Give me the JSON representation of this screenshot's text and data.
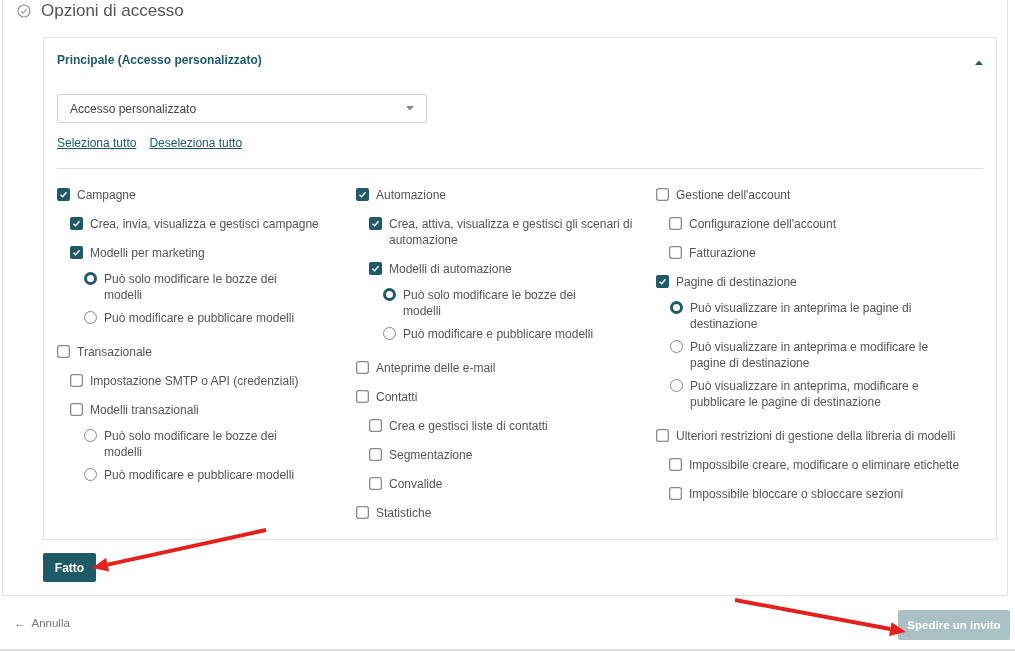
{
  "section": {
    "title": "Opzioni di accesso"
  },
  "card": {
    "title": "Principale (Accesso personalizzato)",
    "expanded": true,
    "select": {
      "value": "Accesso personalizzato"
    },
    "links": [
      "Seleziona tutto",
      "Deseleziona tutto"
    ],
    "columns": [
      [
        {
          "kind": "checkbox",
          "label": "Campagne",
          "checked": true,
          "children": [
            {
              "kind": "checkbox",
              "label": "Crea, invia, visualizza e gestisci campagne",
              "checked": true
            },
            {
              "kind": "checkbox",
              "label": "Modelli per marketing",
              "checked": true,
              "children": [
                {
                  "kind": "radio",
                  "label": "Può solo modificare le bozze dei modelli",
                  "selected": true
                },
                {
                  "kind": "radio",
                  "label": "Può modificare e pubblicare modelli",
                  "selected": false
                }
              ]
            }
          ]
        },
        {
          "kind": "checkbox",
          "label": "Transazionale",
          "checked": false,
          "children": [
            {
              "kind": "checkbox",
              "label": "Impostazione SMTP o API (credenziali)",
              "checked": false
            },
            {
              "kind": "checkbox",
              "label": "Modelli transazionali",
              "checked": false,
              "children": [
                {
                  "kind": "radio",
                  "label": "Può solo modificare le bozze dei modelli",
                  "selected": false
                },
                {
                  "kind": "radio",
                  "label": "Può modificare e pubblicare modelli",
                  "selected": false
                }
              ]
            }
          ]
        }
      ],
      [
        {
          "kind": "checkbox",
          "label": "Automazione",
          "checked": true,
          "children": [
            {
              "kind": "checkbox",
              "label": "Crea, attiva, visualizza e gestisci gli scenari di automazione",
              "checked": true
            },
            {
              "kind": "checkbox",
              "label": "Modelli di automazione",
              "checked": true,
              "children": [
                {
                  "kind": "radio",
                  "label": "Può solo modificare le bozze dei modelli",
                  "selected": true
                },
                {
                  "kind": "radio",
                  "label": "Può modificare e pubblicare modelli",
                  "selected": false
                }
              ]
            }
          ]
        },
        {
          "kind": "checkbox",
          "label": "Anteprime delle e-mail",
          "checked": false
        },
        {
          "kind": "checkbox",
          "label": "Contatti",
          "checked": false,
          "children": [
            {
              "kind": "checkbox",
              "label": "Crea e gestisci liste di contatti",
              "checked": false
            },
            {
              "kind": "checkbox",
              "label": "Segmentazione",
              "checked": false
            },
            {
              "kind": "checkbox",
              "label": "Convalide",
              "checked": false
            }
          ]
        },
        {
          "kind": "checkbox",
          "label": "Statistiche",
          "checked": false
        }
      ],
      [
        {
          "kind": "checkbox",
          "label": "Gestione dell'account",
          "checked": false,
          "children": [
            {
              "kind": "checkbox",
              "label": "Configurazione dell'account",
              "checked": false
            },
            {
              "kind": "checkbox",
              "label": "Fatturazione",
              "checked": false
            }
          ]
        },
        {
          "kind": "checkbox",
          "label": "Pagine di destinazione",
          "checked": true,
          "children": [
            {
              "kind": "radio",
              "label": "Può visualizzare in anteprima le pagine di destinazione",
              "selected": true
            },
            {
              "kind": "radio",
              "label": "Può visualizzare in anteprima e modificare le pagine di destinazione",
              "selected": false
            },
            {
              "kind": "radio",
              "label": "Può visualizzare in anteprima, modificare e pubblicare le pagine di destinazione",
              "selected": false
            }
          ]
        },
        {
          "kind": "checkbox",
          "label": "Ulteriori restrizioni di gestione della libreria di modelli",
          "checked": false,
          "children": [
            {
              "kind": "checkbox",
              "label": "Impossibile creare, modificare o eliminare etichette",
              "checked": false
            },
            {
              "kind": "checkbox",
              "label": "Impossibile bloccare o sbloccare sezioni",
              "checked": false
            }
          ]
        }
      ]
    ]
  },
  "done_button": "Fatto",
  "footer": {
    "cancel": {
      "icon": "←",
      "label": "Annulla"
    },
    "submit": {
      "label": "Spedire un invito",
      "disabled": true
    }
  },
  "annotations": [
    {
      "kind": "arrow"
    },
    {
      "kind": "arrow"
    }
  ]
}
